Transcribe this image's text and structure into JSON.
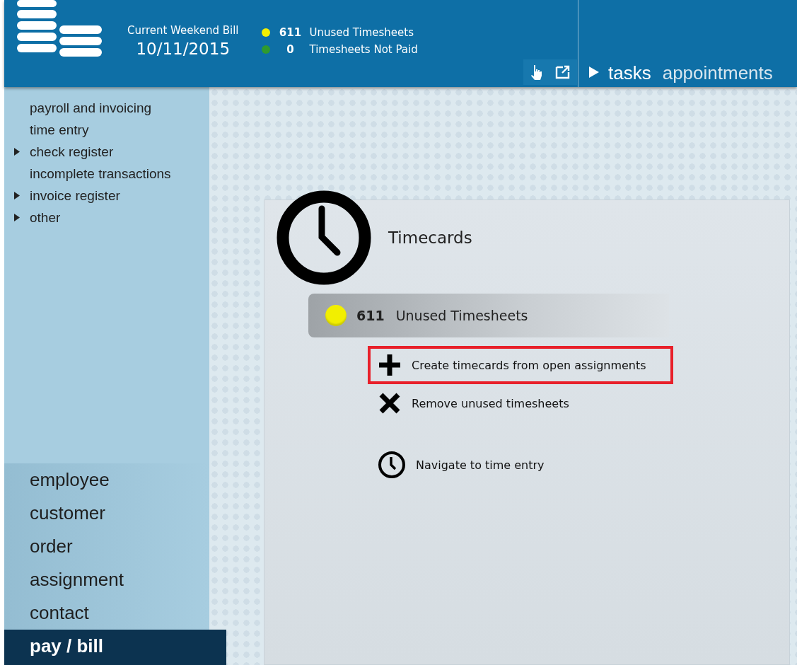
{
  "header": {
    "bill_label": "Current Weekend Bill",
    "bill_date": "10/11/2015",
    "status": [
      {
        "count": "611",
        "label": "Unused Timesheets",
        "color": "#f2ef00"
      },
      {
        "count": "0",
        "label": "Timesheets Not Paid",
        "color": "#2f9a2f"
      }
    ],
    "tabs": [
      {
        "label": "tasks",
        "selected": true
      },
      {
        "label": "appointments",
        "selected": false
      }
    ]
  },
  "sidebar": {
    "menu": [
      {
        "label": "payroll and invoicing",
        "collapsed": false
      },
      {
        "label": "time entry",
        "collapsed": false
      },
      {
        "label": "check register",
        "collapsed": true
      },
      {
        "label": "incomplete transactions",
        "collapsed": false
      },
      {
        "label": "invoice register",
        "collapsed": true
      },
      {
        "label": "other",
        "collapsed": true
      }
    ],
    "nav": [
      {
        "label": "employee",
        "selected": false
      },
      {
        "label": "customer",
        "selected": false
      },
      {
        "label": "order",
        "selected": false
      },
      {
        "label": "assignment",
        "selected": false
      },
      {
        "label": "contact",
        "selected": false
      },
      {
        "label": "pay / bill",
        "selected": true
      }
    ]
  },
  "panel": {
    "title": "Timecards",
    "summary": {
      "count": "611",
      "label": "Unused Timesheets",
      "color": "#f2ef00"
    },
    "actions": [
      {
        "kind": "create",
        "label": "Create timecards from open assignments",
        "highlighted": true
      },
      {
        "kind": "remove",
        "label": "Remove unused timesheets",
        "highlighted": false
      },
      {
        "kind": "navigate",
        "label": "Navigate to time entry",
        "highlighted": false
      }
    ]
  }
}
